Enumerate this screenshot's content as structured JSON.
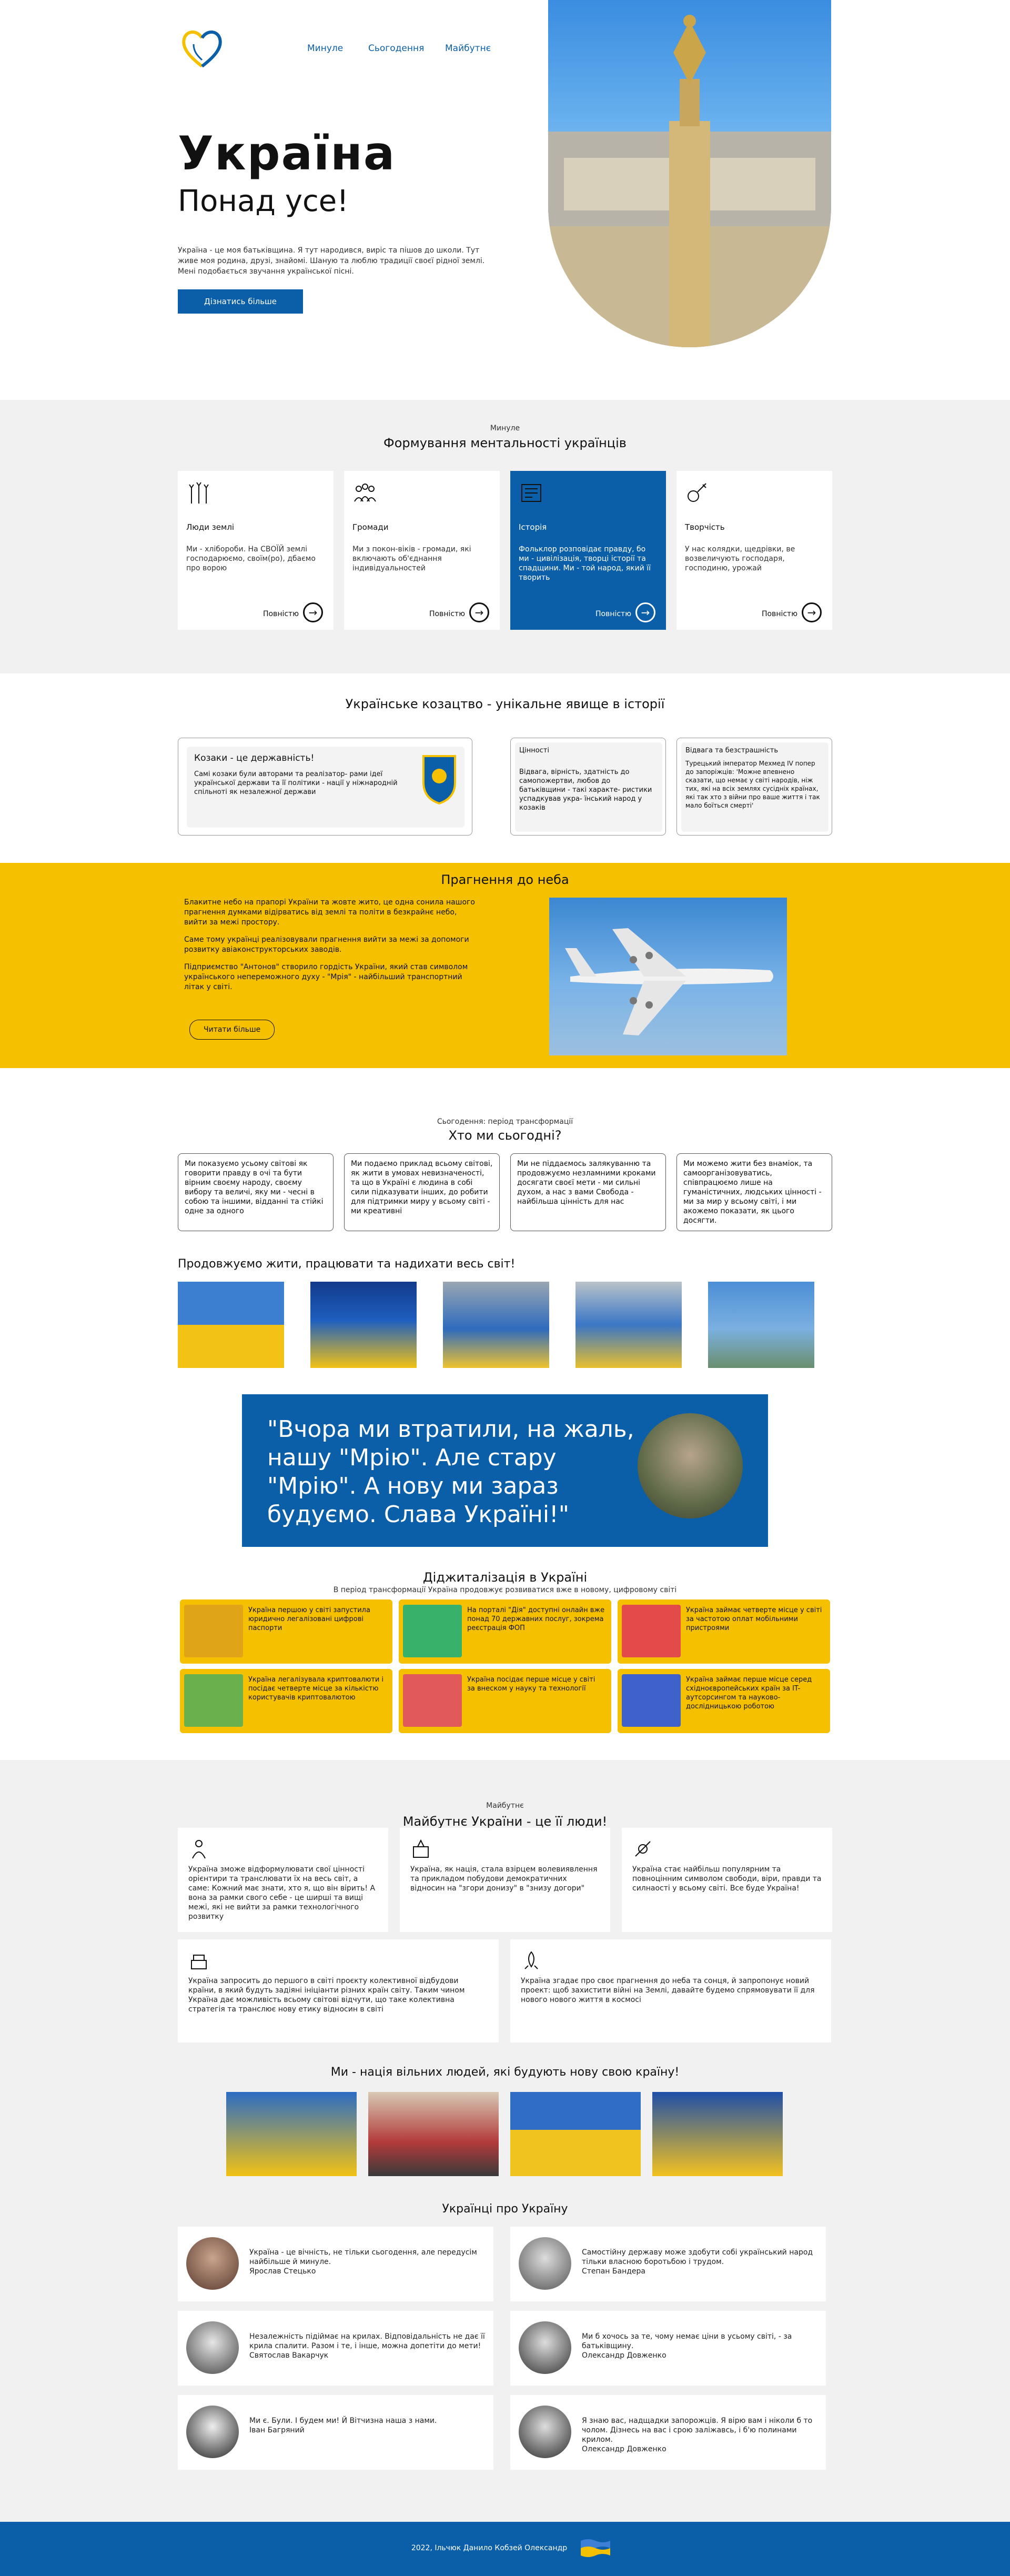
{
  "header": {
    "nav": [
      "Минуле",
      "Сьогодення",
      "Майбутнє"
    ]
  },
  "hero": {
    "title": "Україна",
    "subtitle": "Понад усе!",
    "text": "Україна - це моя батьківщина. Я тут народився, виріс та пішов до школи. Тут живе моя родина, друзі, знайомі. Шаную та люблю традиції своєї рідної землі. Мені подобається звучання української пісні.",
    "button": "Дізнатись більше"
  },
  "past": {
    "label": "Минуле",
    "title": "Формування ментальності українців",
    "more": "Повністю",
    "cards": [
      {
        "title": "Люди землі",
        "desc": "Ми - хлібороби. На СВОЇЙ землі господарюємо, своїм(ро), дбаємо про ворою",
        "icon": "wheat-icon"
      },
      {
        "title": "Громади",
        "desc": "Ми з покон-віків - громади, які включають об'єднання індивідуальностей",
        "icon": "community-icon"
      },
      {
        "title": "Історія",
        "desc": "Фольклор розповідає правду, бо ми - цивілізація, творці історії та спадщини. Ми - той народ, який її творить",
        "icon": "history-icon"
      },
      {
        "title": "Творчість",
        "desc": "У нас колядки, щедрівки, ве возвеличують господаря, господиню, урожай",
        "icon": "music-icon"
      }
    ]
  },
  "cossacks": {
    "title": "Українське козацтво - унікальне явище в історії",
    "card1_title": "Козаки - це державність!",
    "card1_text": "Самі козаки були авторами та реалізатор- рами ідеї української держави та її політики - нації у ніжнародній спільноті як незалежної держави",
    "card2_title": "Цінності",
    "card2_text": "Відвага, вірність, здатність до самопожертви, любов до батьківщини - такі характе- ристики успадкував укра- їнський народ у козаків",
    "card3_title": "Відвага та безстрашність",
    "card3_text": "Турецький імператор Мехмед IV попер до запоріжців: 'Можне впевнено сказати, що немає у світі народів, ніж тих, які на всіх землях сусідніх країнах, які так хто з війни про ваше життя і так мало боїться смерті'"
  },
  "sky": {
    "title": "Прагнення до неба",
    "p1": "Блакитне небо на прапорі України та жовте жито, це одна сонила нашого прагнення думками відірватись від землі та політи в безкрайнє небо, вийти за межі простору.",
    "p2": "Саме тому українці реалізовували прагнення вийти за межі за допомоги розвитку авіаконструкторських заводів.",
    "p3": "Підприємство \"Антонов\" створило гордість України, який став символом українського непереможного духу - \"Мрія\" - найбільший транспортний літак у світі.",
    "button": "Читати більше"
  },
  "today": {
    "label": "Сьогодення: період трансформації",
    "title": "Хто ми сьогодні?",
    "boxes": [
      "Ми показуємо усьому світові як говорити правду в очі та бути вірним своєму народу, своєму вибору та величі, яку ми - чесні в собою та іншими, відданні та стійкі одне за одного",
      "Ми подаємо приклад всьому світові, як жити в умовах невизначеності, та що в Україні є людина в собі сили підказувати інших, до робити для підтримки миру у всьому світі - ми креативні",
      "Ми не піддаємось залякуванню та продовжуємо незламними кроками досягати своєї мети - ми сильні духом, а нас з вами Свобода - найбільша цінність для нас",
      "Ми можемо жити без внаміок, та самоорганізовуватись, співпрацюємо лише на гуманістичних, людських цінності - ми за мир у всьому світі, і ми акожемо показати, як цього досягти."
    ],
    "photos_title": "Продовжуємо жити, працювати та надихати весь світ!"
  },
  "quote": {
    "text": "\"Вчора ми втратили, на жаль, нашу \"Мрію\". Але стару \"Мрію\". А нову ми зараз будуємо. Слава Україні!\""
  },
  "digital": {
    "title": "Діджиталізація в Україні",
    "subtitle": "В період трансформації Україна продовжує розвиватися вже в новому, цифровому світі",
    "items": [
      "Україна першою у світі запустила юридично легалізовані цифрові паспорти",
      "На порталі \"Дія\" доступні онлайн вже понад 70 державних послуг, зокрема реєстрація ФОП",
      "Україна займає четверте місце у світі за частотою оплат мобільними пристроями",
      "Україна легалізувала криптовалюти і посідає четверте місце за кількістю користувачів криптовалютою",
      "Україна посідає перше місце у світі за внеском у науку та технології",
      "Україна займає перше місце серед східноєвропейських країн за IT-аутсорсингом та науково-дослідницькою роботою"
    ]
  },
  "future": {
    "label": "Майбутнє",
    "title": "Майбутнє України - це її люди!",
    "items": [
      "Україна зможе відформулювати свої цінності орієнтири та транслювати їх на весь світ, а саме: Кожний має знати, хто я, що він вірить! А вона за рамки свого себе - це ширші та вищі межі, які не вийти за рамки технологічного розвитку",
      "Україна, як нація, стала взірцем волевиявлення та прикладом побудови демократичних відносин на \"згори донизу\" в \"знизу догори\"",
      "Україна стає найбільш популярним та повноцінним символом свободи, віри, правди та силнаості у всьому світі. Все буде Україна!",
      "Україна запросить до першого в світі проєкту колективної відбудови країни, в який будуть задіяні ініціанти різних країн світу. Таким чином Україна дає можливість всьому світові відчути, що таке колективна стратегія та транслює нову етику відносин в світі",
      "Україна згадає про своє прагнення до неба та сонця, й запропонує новий проект: щоб захистити війні на Землі, давайте будемо спрямовувати її для нового нового життя в космосі"
    ],
    "people_title": "Ми - нація вільних людей, які будують нову свою країну!"
  },
  "quotes": {
    "title": "Українці про Україну",
    "items": [
      {
        "text": "Україна - це вічність, не тільки сьогодення, але передусім найбільше й минуле.",
        "author": "Ярослав Стецько"
      },
      {
        "text": "Самостійну державу може здобути собі український народ тільки власною боротьбою і трудом.",
        "author": "Степан Бандера"
      },
      {
        "text": "Незалежність підіймає на крилах. Відповідальність не дає її крила спалити. Разом і те, і інше, можна допетіти до мети!",
        "author": "Святослав Вакарчук"
      },
      {
        "text": "Ми б хочось за те, чому немає ціни в усьому світі, - за батьківщину.",
        "author": "Олександр Довженко"
      },
      {
        "text": "Ми є. Були. І будем ми! Й Вітчизна наша з нами.",
        "author": "Іван Багряний"
      },
      {
        "text": "Я знаю вас, надщадки запорожців. Я вірю вам і ніколи б то чолом. Дізнесь на вас і срою заліжавсь, і б'ю полинами крилом.",
        "author": "Олександр Довженко"
      }
    ]
  },
  "footer": {
    "text": "2022, Ільчюк Данило Кобзей Олександр"
  },
  "colors": {
    "blue": "#0b5fa8",
    "yellow": "#f5c000"
  }
}
